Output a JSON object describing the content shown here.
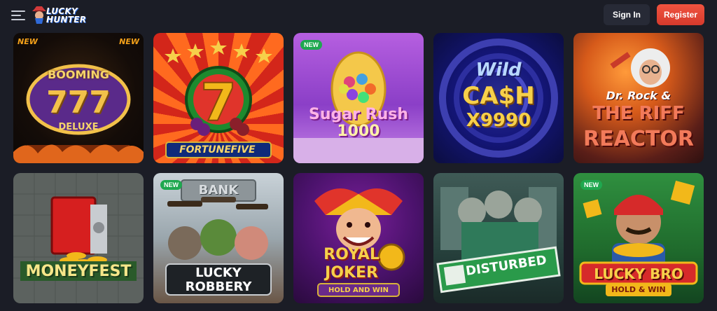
{
  "header": {
    "logo_line1": "LUCKY",
    "logo_line2": "HUNTER",
    "signin_label": "Sign In",
    "register_label": "Register"
  },
  "games": [
    {
      "id": "booming-777-deluxe",
      "title_l1": "BOOMING",
      "title_l2": "777",
      "title_l3": "DELUXE",
      "badge_left": "NEW",
      "badge_right": "NEW"
    },
    {
      "id": "fortune-five",
      "title_l1": "FORTUNE",
      "title_l2": "FIVE"
    },
    {
      "id": "sugar-rush-1000",
      "title_l1": "Sugar Rush",
      "title_l2": "1000",
      "badge": "NEW"
    },
    {
      "id": "wild-cash-x9990",
      "title_l1": "Wild",
      "title_l2": "CA$H",
      "title_l3": "X9990"
    },
    {
      "id": "dr-rock-riff-reactor",
      "title_l1": "Dr. Rock &",
      "title_l2": "THE RIFF",
      "title_l3": "REACTOR"
    },
    {
      "id": "moneyfest",
      "title_l1": "MONEYFEST"
    },
    {
      "id": "lucky-robbery",
      "title_l1": "LUCKY",
      "title_l2": "ROBBERY",
      "sign": "BANK",
      "badge": "NEW"
    },
    {
      "id": "royal-joker",
      "title_l1": "ROYAL",
      "title_l2": "JOKER",
      "subtitle": "HOLD AND WIN"
    },
    {
      "id": "disturbed",
      "title_l1": "DISTURBED"
    },
    {
      "id": "lucky-bro",
      "title_l1": "LUCKY BRO",
      "subtitle": "HOLD & WIN",
      "badge": "NEW"
    }
  ],
  "colors": {
    "page_bg": "#1b1d26",
    "signin_bg": "#272a36",
    "register_bg": "#e8473a",
    "new_badge": "#1fa84f"
  }
}
